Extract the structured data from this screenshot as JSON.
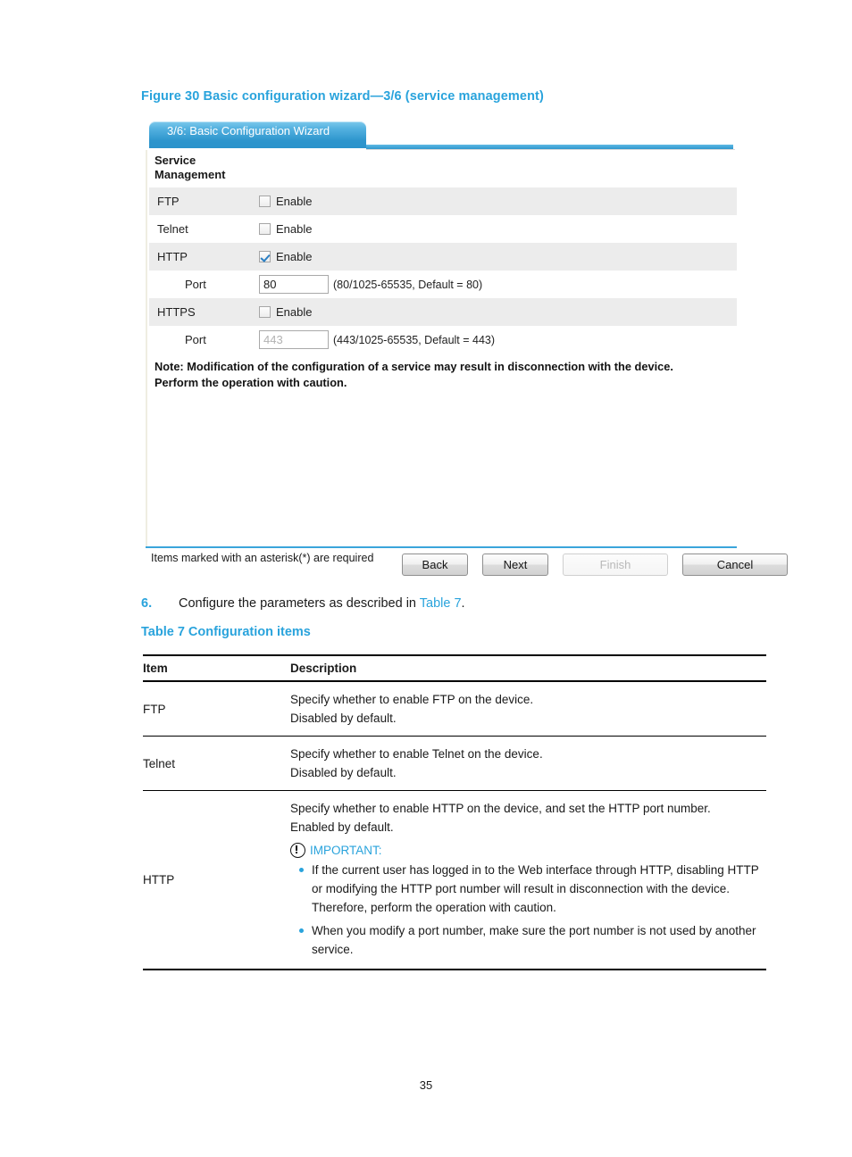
{
  "figure": {
    "caption": "Figure 30 Basic configuration wizard—3/6 (service management)"
  },
  "wizard": {
    "tab_label": "3/6: Basic Configuration Wizard",
    "section_title": "Service Management",
    "rows": [
      {
        "name": "FTP",
        "control": "checkbox",
        "checkbox_label": "Enable",
        "checked": false
      },
      {
        "name": "Telnet",
        "control": "checkbox",
        "checkbox_label": "Enable",
        "checked": false
      },
      {
        "name": "HTTP",
        "control": "checkbox",
        "checkbox_label": "Enable",
        "checked": true
      },
      {
        "name": "Port",
        "control": "input",
        "value": "80",
        "hint": "(80/1025-65535, Default = 80)",
        "disabled": false
      },
      {
        "name": "HTTPS",
        "control": "checkbox",
        "checkbox_label": "Enable",
        "checked": false
      },
      {
        "name": "Port",
        "control": "input",
        "value": "443",
        "hint": "(443/1025-65535, Default = 443)",
        "disabled": true
      }
    ],
    "note": "Note: Modification of the configuration of a service may result in disconnection with the device. Perform the operation with caution.",
    "footer_note": "Items marked with an asterisk(*) are required",
    "buttons": [
      {
        "label": "Back",
        "disabled": false
      },
      {
        "label": "Next",
        "disabled": false
      },
      {
        "label": "Finish",
        "disabled": true
      },
      {
        "label": "Cancel",
        "disabled": false
      }
    ],
    "colors": {
      "tab_blue": "#2d95cd",
      "accent_blue": "#3aa5db",
      "row_shade": "#ececec"
    }
  },
  "step": {
    "number": "6.",
    "text_before": "Configure the parameters as described in ",
    "link": "Table 7",
    "text_after": "."
  },
  "table": {
    "caption": "Table 7 Configuration items",
    "headers": {
      "item": "Item",
      "description": "Description"
    },
    "rows": [
      {
        "item": "FTP",
        "lines": [
          "Specify whether to enable FTP on the device.",
          "Disabled by default."
        ]
      },
      {
        "item": "Telnet",
        "lines": [
          "Specify whether to enable Telnet on the device.",
          "Disabled by default."
        ]
      },
      {
        "item": "HTTP",
        "lines": [
          "Specify whether to enable HTTP on the device, and set the HTTP port number.",
          "Enabled by default."
        ],
        "important_label": "IMPORTANT:",
        "bullets": [
          "If the current user has logged in to the Web interface through HTTP, disabling HTTP or modifying the HTTP port number will result in disconnection with the device. Therefore, perform the operation with caution.",
          "When you modify a port number, make sure the port number is not used by another service."
        ]
      }
    ]
  },
  "footer": {
    "page_number": "35"
  }
}
